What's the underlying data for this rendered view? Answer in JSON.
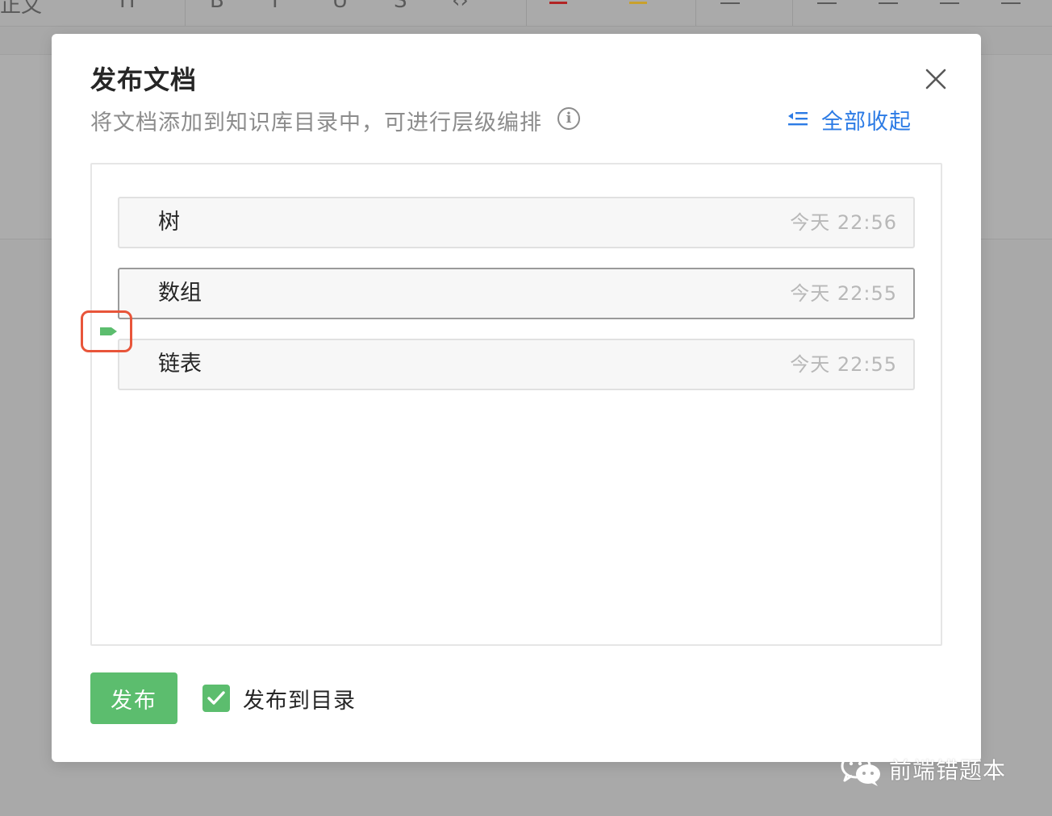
{
  "dialog": {
    "title": "发布文档",
    "subtitle": "将文档添加到知识库目录中，可进行层级编排",
    "collapse_all_label": "全部收起"
  },
  "tree": {
    "nodes": [
      {
        "title": "树",
        "time": "今天 22:56"
      },
      {
        "title": "数组",
        "time": "今天 22:55"
      },
      {
        "title": "链表",
        "time": "今天 22:55"
      }
    ]
  },
  "footer": {
    "publish_label": "发布",
    "publish_to_catalog_label": "发布到目录",
    "publish_to_catalog_checked": true
  },
  "watermark": {
    "text": "前端错题本"
  },
  "icons": {
    "close": "close-icon",
    "info": "info-icon",
    "collapse": "collapse-all-icon",
    "drop": "drop-position-marker-icon",
    "check": "check-icon",
    "wechat": "wechat-logo"
  },
  "colors": {
    "accent_green": "#5cbd6e",
    "link_blue": "#2c7be5",
    "drop_highlight": "#e8553a"
  }
}
